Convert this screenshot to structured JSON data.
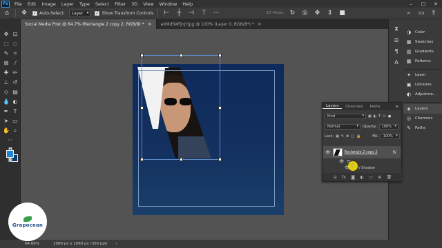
{
  "app": {
    "logo": "Ps"
  },
  "menu": [
    "File",
    "Edit",
    "Image",
    "Layer",
    "Type",
    "Select",
    "Filter",
    "3D",
    "View",
    "Window",
    "Help"
  ],
  "options": {
    "auto_select_label": "Auto-Select:",
    "auto_select_value": "Layer",
    "show_transform_label": "Show Transform Controls",
    "mode_3d": "3D Mode:"
  },
  "tabs": [
    {
      "label": "Social Media Post @ 64.7% (Rectangle 2 copy 2, RGB/8) *",
      "active": true
    },
    {
      "label": "aXMdSWfjnJYjpg @ 100% (Layer 0, RGB/8*) *",
      "active": false
    }
  ],
  "right_panel": {
    "group1": [
      "Color",
      "Swatches",
      "Gradients",
      "Patterns"
    ],
    "group2": [
      "Learn",
      "Libraries",
      "Adjustme..."
    ],
    "group3": [
      "Layers",
      "Channels",
      "Paths"
    ]
  },
  "layers_panel": {
    "tabs": [
      "Layers",
      "Channels",
      "Paths"
    ],
    "filter_kind": "Kind",
    "blend_mode": "Normal",
    "opacity_label": "Opacity:",
    "opacity_value": "100%",
    "lock_label": "Lock:",
    "fill_label": "Fill:",
    "fill_value": "100%",
    "layer_name": "Rectangle 2 copy 2",
    "fx_label": "fx",
    "effects_label": "Ef",
    "shadow_label": "y Shadow"
  },
  "status": {
    "zoom": "64.66%",
    "doc_info": "1080 px x 1080 px (300 ppi)"
  },
  "watermark": {
    "text": "Grapocean"
  },
  "colors": {
    "foreground": "#1b86d1",
    "background": "#0d3a6e",
    "highlight": "#ffeb00"
  }
}
